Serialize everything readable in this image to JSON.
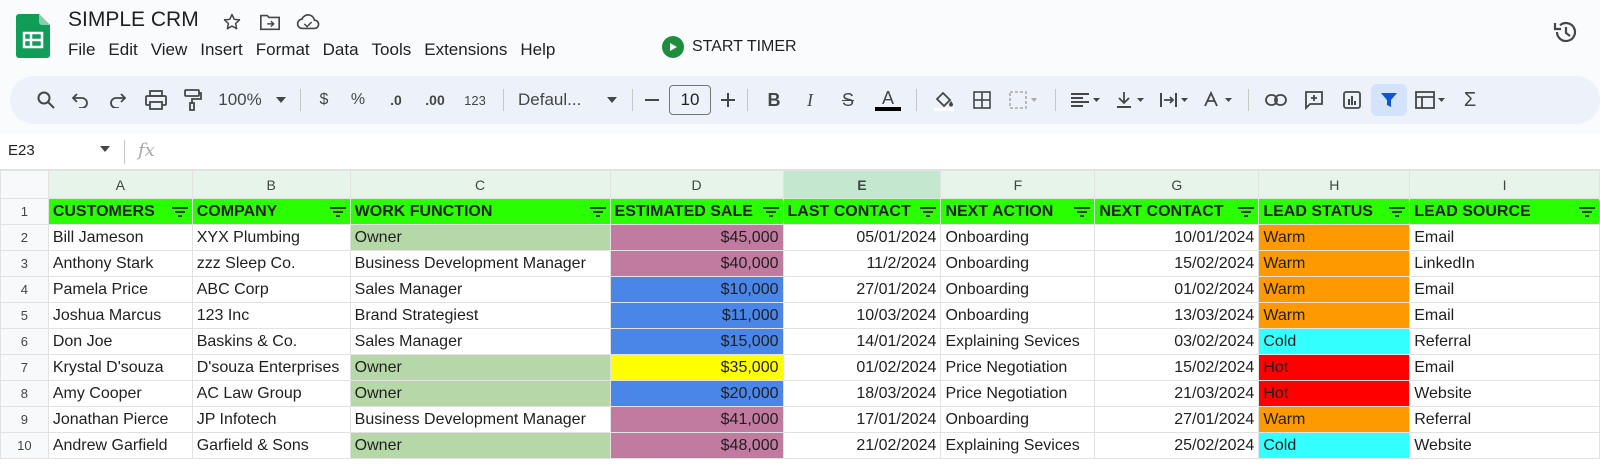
{
  "app": {
    "title": "SIMPLE CRM",
    "menu": [
      "File",
      "Edit",
      "View",
      "Insert",
      "Format",
      "Data",
      "Tools",
      "Extensions",
      "Help"
    ],
    "timer_label": "START TIMER"
  },
  "toolbar": {
    "zoom": "100%",
    "currency": "$",
    "percent": "%",
    "dec_decrease": ".0",
    "dec_increase": ".00",
    "number_format": "123",
    "font": "Defaul...",
    "font_size": "10"
  },
  "formula_bar": {
    "cell_ref": "E23",
    "fx": "fx"
  },
  "sheet": {
    "columns": [
      "A",
      "B",
      "C",
      "D",
      "E",
      "F",
      "G",
      "H",
      "I"
    ],
    "headers": [
      "CUSTOMERS",
      "COMPANY",
      "WORK FUNCTION",
      "ESTIMATED SALE",
      "LAST CONTACT",
      "NEXT ACTION",
      "NEXT CONTACT",
      "LEAD STATUS",
      "LEAD SOURCE"
    ],
    "rows": [
      {
        "num": "1"
      },
      {
        "num": "2",
        "cells": [
          "Bill Jameson",
          "XYX Plumbing",
          "Owner",
          "$45,000",
          "05/01/2024",
          "Onboarding",
          "10/01/2024",
          "Warm",
          "Email"
        ]
      },
      {
        "num": "3",
        "cells": [
          "Anthony Stark",
          "zzz Sleep Co.",
          "Business Development Manager",
          "$40,000",
          "11/2/2024",
          "Onboarding",
          "15/02/2024",
          "Warm",
          "LinkedIn"
        ]
      },
      {
        "num": "4",
        "cells": [
          "Pamela Price",
          "ABC Corp",
          "Sales Manager",
          "$10,000",
          "27/01/2024",
          "Onboarding",
          "01/02/2024",
          "Warm",
          "Email"
        ]
      },
      {
        "num": "5",
        "cells": [
          "Joshua Marcus",
          "123 Inc",
          "Brand Strategiest",
          "$11,000",
          "10/03/2024",
          "Onboarding",
          "13/03/2024",
          "Warm",
          "Email"
        ]
      },
      {
        "num": "6",
        "cells": [
          "Don Joe",
          "Baskins & Co.",
          "Sales Manager",
          "$15,000",
          "14/01/2024",
          "Explaining Sevices",
          "03/02/2024",
          "Cold",
          "Referral"
        ]
      },
      {
        "num": "7",
        "cells": [
          "Krystal D'souza",
          "D'souza Enterprises",
          "Owner",
          "$35,000",
          "01/02/2024",
          "Price Negotiation",
          "15/02/2024",
          "Hot",
          "Email"
        ]
      },
      {
        "num": "8",
        "cells": [
          "Amy Cooper",
          "AC Law Group",
          "Owner",
          "$20,000",
          "18/03/2024",
          "Price Negotiation",
          "21/03/2024",
          "Hot",
          "Website"
        ]
      },
      {
        "num": "9",
        "cells": [
          "Jonathan Pierce",
          "JP Infotech",
          "Business Development Manager",
          "$41,000",
          "17/01/2024",
          "Onboarding",
          "27/01/2024",
          "Warm",
          "Referral"
        ]
      },
      {
        "num": "10",
        "cells": [
          "Andrew Garfield",
          "Garfield & Sons",
          "Owner",
          "$48,000",
          "21/02/2024",
          "Explaining Sevices",
          "25/02/2024",
          "Cold",
          "Website"
        ]
      }
    ],
    "colors": {
      "header_green": "#2aff00",
      "owner_green": "#b6d7a8",
      "sale_pink": "#c27ba0",
      "sale_blue": "#4a86e8",
      "sale_yellow": "#ffff00",
      "warm": "#ff9900",
      "cold": "#33ffff",
      "hot": "#ff0000"
    }
  }
}
